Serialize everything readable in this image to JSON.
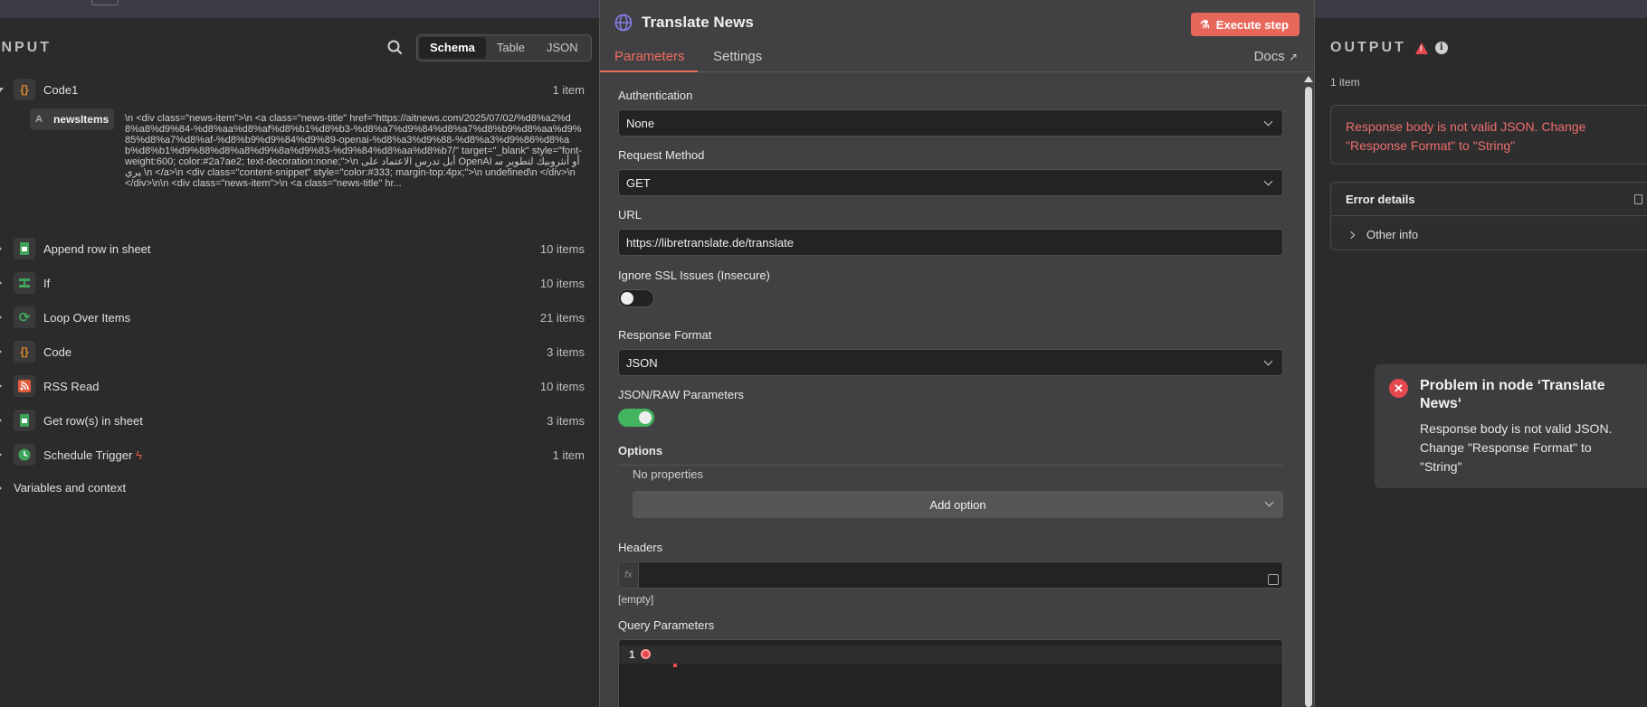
{
  "input": {
    "title": "INPUT",
    "view_tabs": [
      "Schema",
      "Table",
      "JSON"
    ],
    "nodes": [
      {
        "label": "Code1",
        "count": "1 item",
        "icon": "code-braces-icon",
        "color": "#e08a2f",
        "glyph": "{}"
      },
      {
        "label": "Append row in sheet",
        "count": "10 items",
        "icon": "sheets-icon",
        "color": "#3fa45b",
        "glyph": "▤"
      },
      {
        "label": "If",
        "count": "10 items",
        "icon": "if-branch-icon",
        "color": "#3fa45b",
        "glyph": "⇅"
      },
      {
        "label": "Loop Over Items",
        "count": "21 items",
        "icon": "loop-icon",
        "color": "#3fa45b",
        "glyph": "⟳"
      },
      {
        "label": "Code",
        "count": "3 items",
        "icon": "code-braces-icon",
        "color": "#e08a2f",
        "glyph": "{}"
      },
      {
        "label": "RSS Read",
        "count": "10 items",
        "icon": "rss-icon",
        "color": "#e25a3b",
        "glyph": "◥"
      },
      {
        "label": "Get row(s) in sheet",
        "count": "3 items",
        "icon": "sheets-icon",
        "color": "#3fa45b",
        "glyph": "▤"
      },
      {
        "label": "Schedule Trigger",
        "count": "1 item",
        "icon": "clock-icon",
        "color": "#3fa45b",
        "glyph": "◷"
      }
    ],
    "field": {
      "type": "A",
      "name": "newsItems",
      "value": "\\n <div class=\"news-item\">\\n <a class=\"news-title\" href=\"https://aitnews.com/2025/07/02/%d8%a2%d8%a8%d9%84-%d8%aa%d8%af%d8%b1%d8%b3-%d8%a7%d9%84%d8%a7%d8%b9%d8%aa%d9%85%d8%a7%d8%af-%d8%b9%d9%84%d9%89-openai-%d8%a3%d9%88-%d8%a3%d9%86%d8%ab%d8%b1%d9%88%d8%a8%d9%8a%d9%83-%d9%84%d8%aa%d8%b7/\" target=\"_blank\" style=\"font-weight:600; color:#2a7ae2; text-decoration:none;\">\\n أبل تدرس الاعتماد على OpenAI أو أنثروبيك لتطوير سيري \\n </a>\\n <div class=\"content-snippet\" style=\"color:#333; margin-top:4px;\">\\n undefined\\n </div>\\n </div>\\n\\n <div class=\"news-item\">\\n <a class=\"news-title\" hr..."
    },
    "variables_label": "Variables and context"
  },
  "node": {
    "title": "Translate News",
    "execute_label": "Execute step",
    "tabs": [
      "Parameters",
      "Settings"
    ],
    "docs_label": "Docs",
    "auth_label": "Authentication",
    "auth_value": "None",
    "method_label": "Request Method",
    "method_value": "GET",
    "url_label": "URL",
    "url_value": "https://libretranslate.de/translate",
    "ssl_label": "Ignore SSL Issues (Insecure)",
    "response_label": "Response Format",
    "response_value": "JSON",
    "json_raw_label": "JSON/RAW Parameters",
    "options_label": "Options",
    "no_props": "No properties",
    "add_option": "Add option",
    "headers_label": "Headers",
    "fx": "fx",
    "headers_empty": "[empty]",
    "query_label": "Query Parameters",
    "line_number": "1"
  },
  "output": {
    "title": "OUTPUT",
    "count": "1 item",
    "error_message": "Response body is not valid JSON. Change \"Response Format\" to \"String\"",
    "details_label": "Error details",
    "other_info": "Other info"
  },
  "toast": {
    "title": "Problem in node ‘Translate News‘",
    "message": "Response body is not valid JSON. Change \"Response Format\" to \"String\""
  },
  "colors": {
    "accent": "#ee6d5e",
    "error": "#e5484d",
    "toggle_on": "#44b35f"
  }
}
